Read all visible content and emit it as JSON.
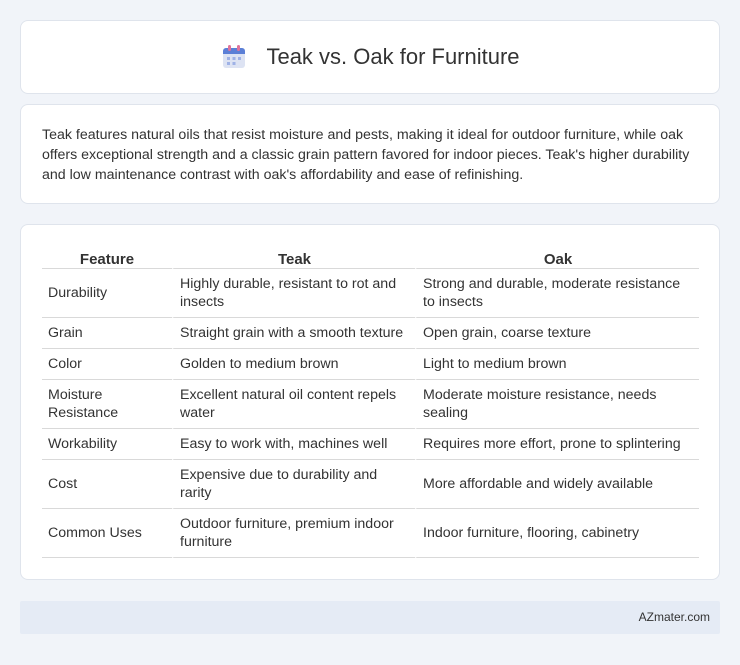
{
  "header": {
    "title": "Teak vs. Oak for Furniture",
    "icon": "calendar-icon"
  },
  "summary": {
    "text": "Teak features natural oils that resist moisture and pests, making it ideal for outdoor furniture, while oak offers exceptional strength and a classic grain pattern favored for indoor pieces. Teak's higher durability and low maintenance contrast with oak's affordability and ease of refinishing."
  },
  "table": {
    "headers": [
      "Feature",
      "Teak",
      "Oak"
    ],
    "rows": [
      [
        "Durability",
        "Highly durable, resistant to rot and insects",
        "Strong and durable, moderate resistance to insects"
      ],
      [
        "Grain",
        "Straight grain with a smooth texture",
        "Open grain, coarse texture"
      ],
      [
        "Color",
        "Golden to medium brown",
        "Light to medium brown"
      ],
      [
        "Moisture Resistance",
        "Excellent natural oil content repels water",
        "Moderate moisture resistance, needs sealing"
      ],
      [
        "Workability",
        "Easy to work with, machines well",
        "Requires more effort, prone to splintering"
      ],
      [
        "Cost",
        "Expensive due to durability and rarity",
        "More affordable and widely available"
      ],
      [
        "Common Uses",
        "Outdoor furniture, premium indoor furniture",
        "Indoor furniture, flooring, cabinetry"
      ]
    ]
  },
  "footer": {
    "source": "AZmater.com"
  }
}
